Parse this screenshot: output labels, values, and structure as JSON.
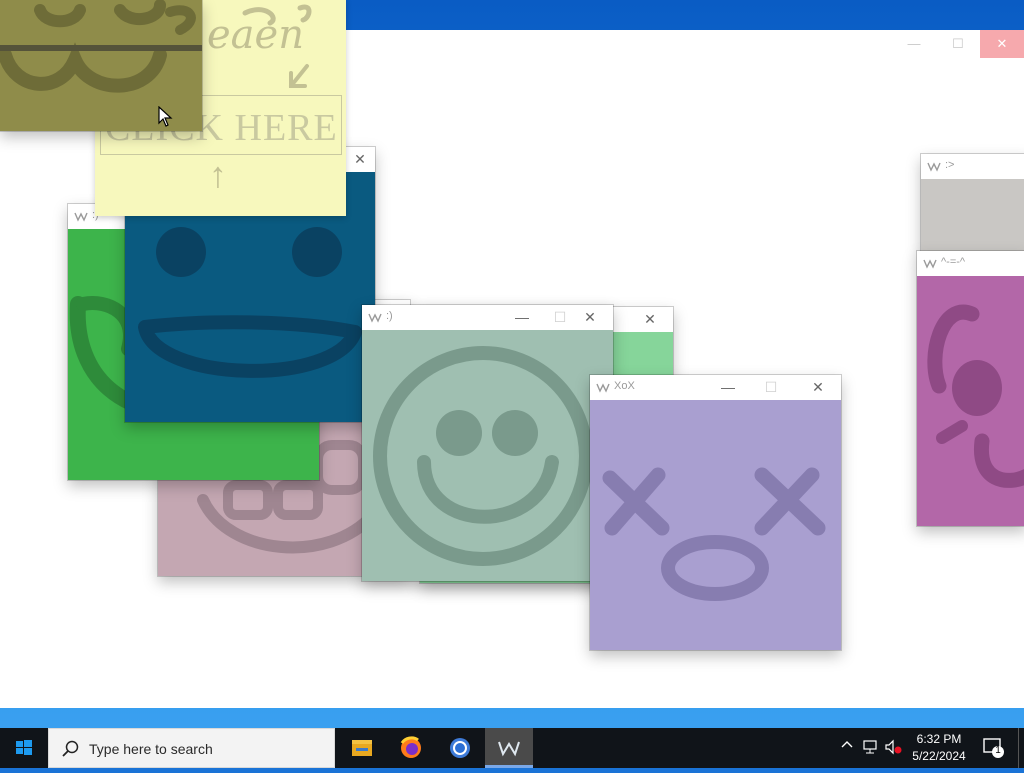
{
  "windows": {
    "blue_face": {
      "title": ""
    },
    "green_face": {
      "title": ":)"
    },
    "mint_face": {
      "title": ":)"
    },
    "purple_face": {
      "title": "XoX"
    },
    "gray_face": {
      "title": ":>"
    },
    "magenta_face": {
      "title": "^-=-^"
    }
  },
  "window_buttons": {
    "minimize": "—",
    "maximize": "☐",
    "close": "✕"
  },
  "sticky_note": {
    "handwriting": "eaen",
    "click_text": "CLICK HERE",
    "arrow": "↑",
    "arrow2": "↙"
  },
  "taskbar": {
    "search_placeholder": "Type here to search",
    "time": "6:32 PM",
    "date": "5/22/2024",
    "notification_count": "1",
    "pinned": [
      "file-explorer",
      "firefox",
      "chrome",
      "faces-app"
    ]
  },
  "colors": {
    "blue_face": "#0a5a80",
    "green_face": "#3db44b",
    "mint_face": "#9fbfb1",
    "purple_face": "#a99fd0",
    "pink_face": "#c4a7b2",
    "gray_face": "#c9c7c4",
    "magenta_face": "#b367a8",
    "olive_face": "#8f8c4a",
    "sticky_note": "#f7f8bd"
  }
}
